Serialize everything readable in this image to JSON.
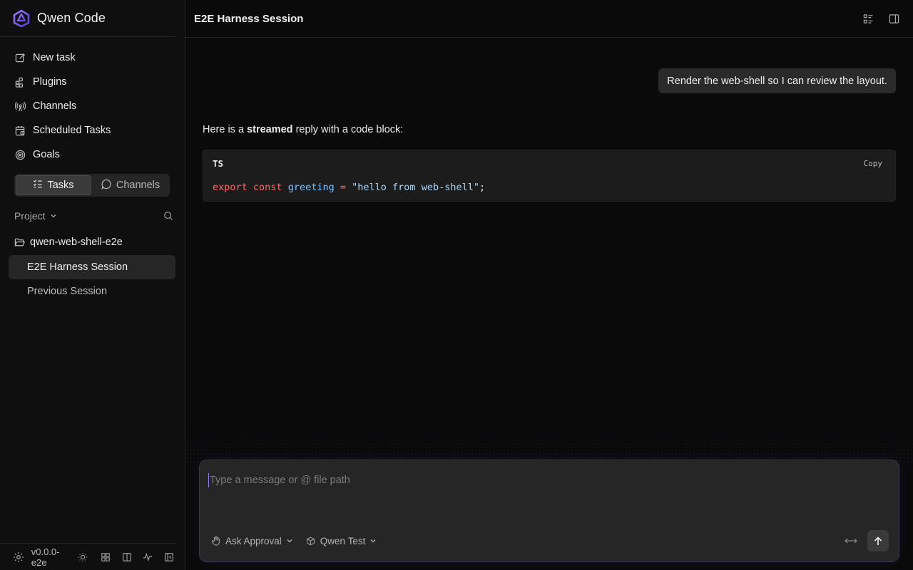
{
  "app": {
    "name": "Qwen Code",
    "version": "v0.0.0-e2e"
  },
  "sidebar": {
    "nav": [
      {
        "label": "New task",
        "icon": "edit-icon"
      },
      {
        "label": "Plugins",
        "icon": "plugins-icon"
      },
      {
        "label": "Channels",
        "icon": "broadcast-icon"
      },
      {
        "label": "Scheduled Tasks",
        "icon": "calendar-clock-icon"
      },
      {
        "label": "Goals",
        "icon": "target-icon"
      }
    ],
    "segment": {
      "tasks": "Tasks",
      "channels": "Channels",
      "active": "tasks"
    },
    "project_label": "Project",
    "folder": "qwen-web-shell-e2e",
    "sessions": [
      {
        "label": "E2E Harness Session",
        "active": true
      },
      {
        "label": "Previous Session",
        "active": false
      }
    ]
  },
  "header": {
    "title": "E2E Harness Session"
  },
  "chat": {
    "user_message": "Render the web-shell so I can review the layout.",
    "assistant_prefix": "Here is a ",
    "assistant_bold": "streamed",
    "assistant_suffix": " reply with a code block:",
    "code": {
      "language": "TS",
      "copy_label": "Copy",
      "tokens": {
        "kw1": "export",
        "kw2": "const",
        "ident": "greeting",
        "op": "=",
        "string": "\"hello from web-shell\"",
        "semicolon": ";"
      }
    }
  },
  "composer": {
    "placeholder": "Type a message or @ file path",
    "approval_mode": "Ask Approval",
    "model": "Qwen Test"
  },
  "colors": {
    "background": "#0a0a0a",
    "accent": "#7c5cff",
    "code_keyword": "#ff6b6b",
    "code_ident": "#7cc4ff",
    "code_string": "#a8d8ff"
  }
}
